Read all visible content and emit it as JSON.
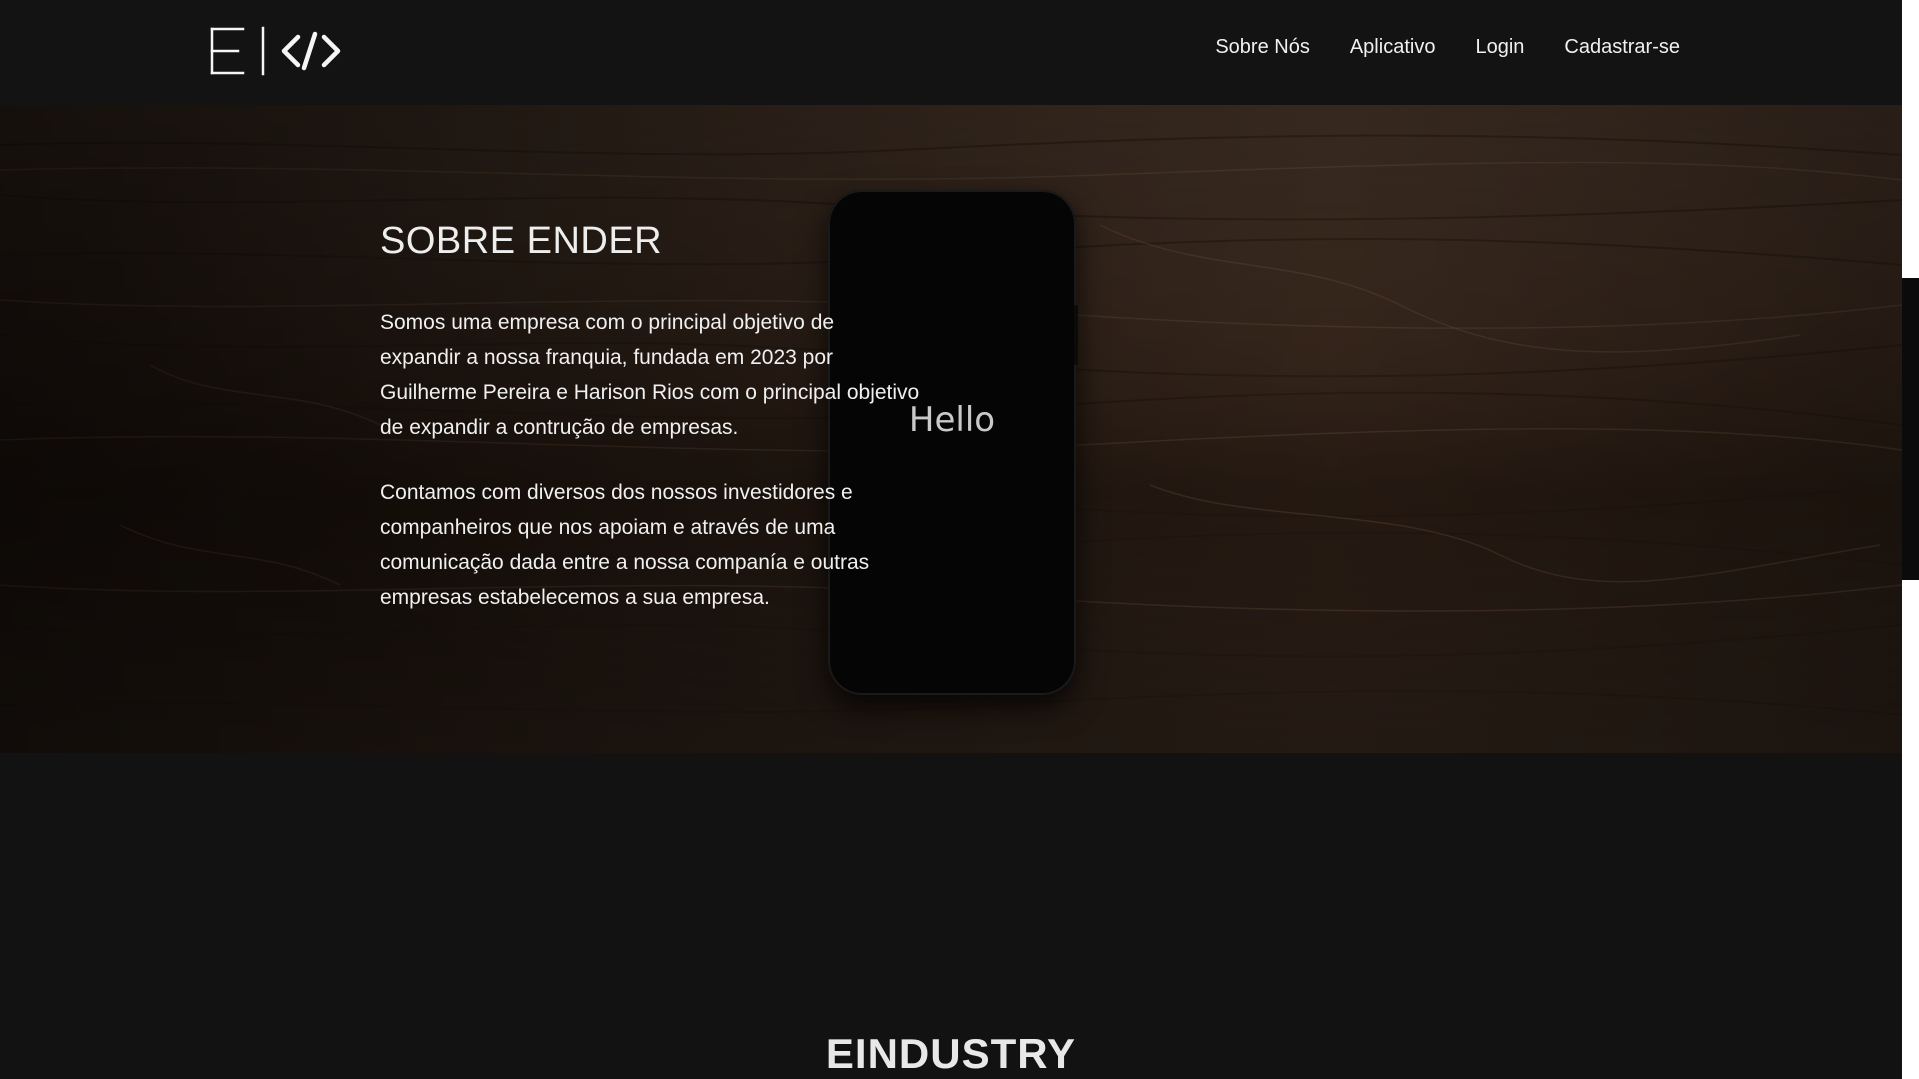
{
  "header": {
    "logo_label": "E | </>",
    "nav": [
      {
        "label": "Sobre Nós"
      },
      {
        "label": "Aplicativo"
      },
      {
        "label": "Login"
      },
      {
        "label": "Cadastrar-se"
      }
    ]
  },
  "hero": {
    "title": "SOBRE ENDER",
    "paragraph1": "Somos uma empresa com o principal objetivo de expandir a nossa franquia, fundada em 2023 por Guilherme Pereira e Harison Rios com o principal objetivo de expandir a contrução de empresas.",
    "paragraph2": "Contamos com diversos dos nossos investidores e companheiros que nos apoiam e através de uma comunicação dada entre a nossa companía e outras empresas estabelecemos a sua empresa.",
    "phone_text": "Hello"
  },
  "section2": {
    "title": "EINDUSTRY"
  },
  "colors": {
    "background": "#121212",
    "header": "#131313",
    "wood_dark": "#2b1d14",
    "wood_light": "#4a372a",
    "text": "#f0f0f0"
  },
  "icons": {
    "logo": "e-code-logo-icon"
  }
}
